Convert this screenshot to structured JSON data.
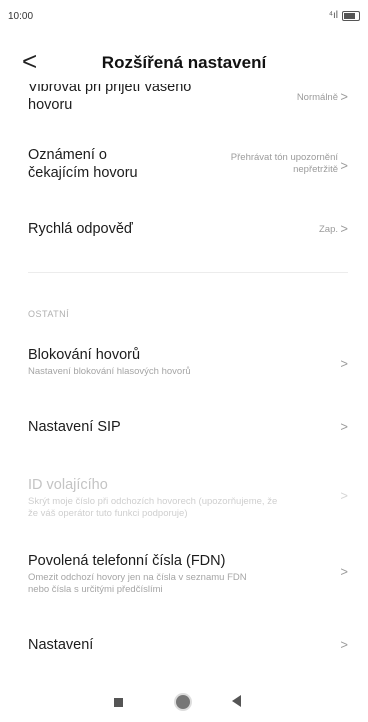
{
  "status": {
    "time": "10:00",
    "signal": "⁴ıl",
    "battery_label": ""
  },
  "header": {
    "back_glyph": "<",
    "title": "Rozšířená nastavení"
  },
  "rows": [
    {
      "main_line1": "Vibrovat při přijetí vašeho",
      "main_line2": "hovoru",
      "value": "Normálně"
    },
    {
      "main_line1": "Oznámení o",
      "main_line2": "čekajícím hovoru",
      "value_line1": "Přehrávat tón upozornění",
      "value_line2": "nepřetržitě"
    },
    {
      "main": "Rychlá odpověď",
      "value": "Zap."
    },
    {
      "main": "Blokování hovorů",
      "sub": "Nastavení blokování hlasových hovorů"
    },
    {
      "main": "Nastavení SIP"
    },
    {
      "main": "ID volajícího",
      "sub_line1": "Skrýt moje číslo při odchozích hovorech (upozorňujeme, že",
      "sub_line2": "že váš operátor tuto funkci podporuje)"
    },
    {
      "main": "Povolená telefonní čísla (FDN)",
      "sub_line1": "Omezit odchozí hovory jen na čísla v seznamu FDN",
      "sub_line2": "nebo čísla s určitými předčíslími"
    },
    {
      "main": "Nastavení"
    }
  ],
  "section_other": "OSTATNÍ",
  "chevron": ">"
}
